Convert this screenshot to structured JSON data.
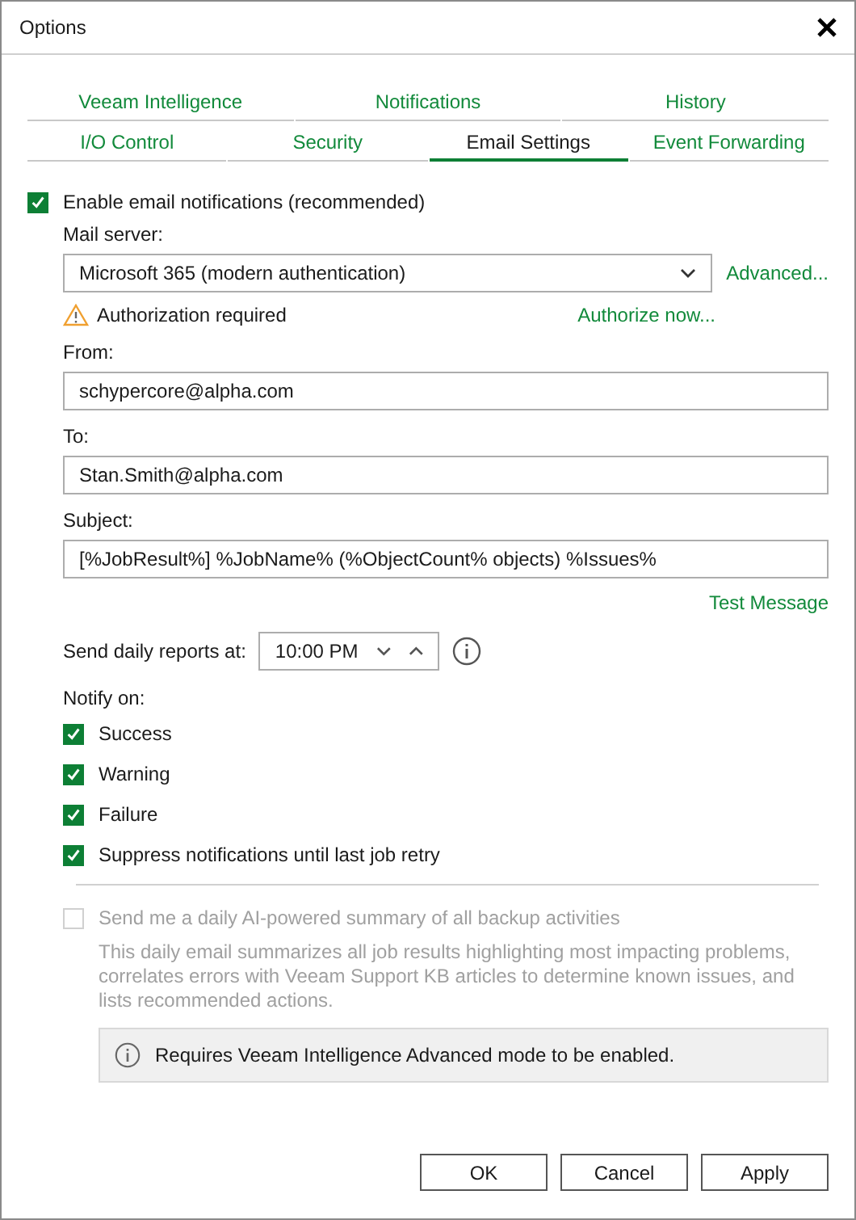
{
  "window": {
    "title": "Options"
  },
  "tab_rows": [
    [
      {
        "label": "Veeam Intelligence",
        "selected": false
      },
      {
        "label": "Notifications",
        "selected": false
      },
      {
        "label": "History",
        "selected": false
      }
    ],
    [
      {
        "label": "I/O Control",
        "selected": false
      },
      {
        "label": "Security",
        "selected": false
      },
      {
        "label": "Email Settings",
        "selected": true
      },
      {
        "label": "Event Forwarding",
        "selected": false
      }
    ]
  ],
  "enable": {
    "label": "Enable email notifications (recommended)",
    "checked": true
  },
  "mail_server": {
    "label": "Mail server:",
    "value": "Microsoft 365 (modern authentication)",
    "link": "Advanced..."
  },
  "auth": {
    "warning": "Authorization required",
    "link": "Authorize now..."
  },
  "fields": [
    {
      "label": "From:",
      "value": "schypercore@alpha.com"
    },
    {
      "label": "To:",
      "value": "Stan.Smith@alpha.com"
    },
    {
      "label": "Subject:",
      "value": "[%JobResult%] %JobName% (%ObjectCount% objects) %Issues%"
    }
  ],
  "test_link": "Test Message",
  "daily": {
    "label": "Send daily reports at:",
    "value": "10:00 PM"
  },
  "notify": {
    "label": "Notify on:",
    "options": [
      {
        "label": "Success",
        "checked": true
      },
      {
        "label": "Warning",
        "checked": true
      },
      {
        "label": "Failure",
        "checked": true
      },
      {
        "label": "Suppress notifications until last job retry",
        "checked": true
      }
    ]
  },
  "ai_summary": {
    "label": "Send me a daily AI-powered summary of all backup activities",
    "checked": false,
    "disabled": true,
    "description": "This daily email summarizes all job results highlighting most impacting problems, correlates errors with Veeam Support KB articles to determine known issues, and lists recommended actions.",
    "note": "Requires Veeam Intelligence Advanced mode to be enabled."
  },
  "buttons": [
    "OK",
    "Cancel",
    "Apply"
  ]
}
